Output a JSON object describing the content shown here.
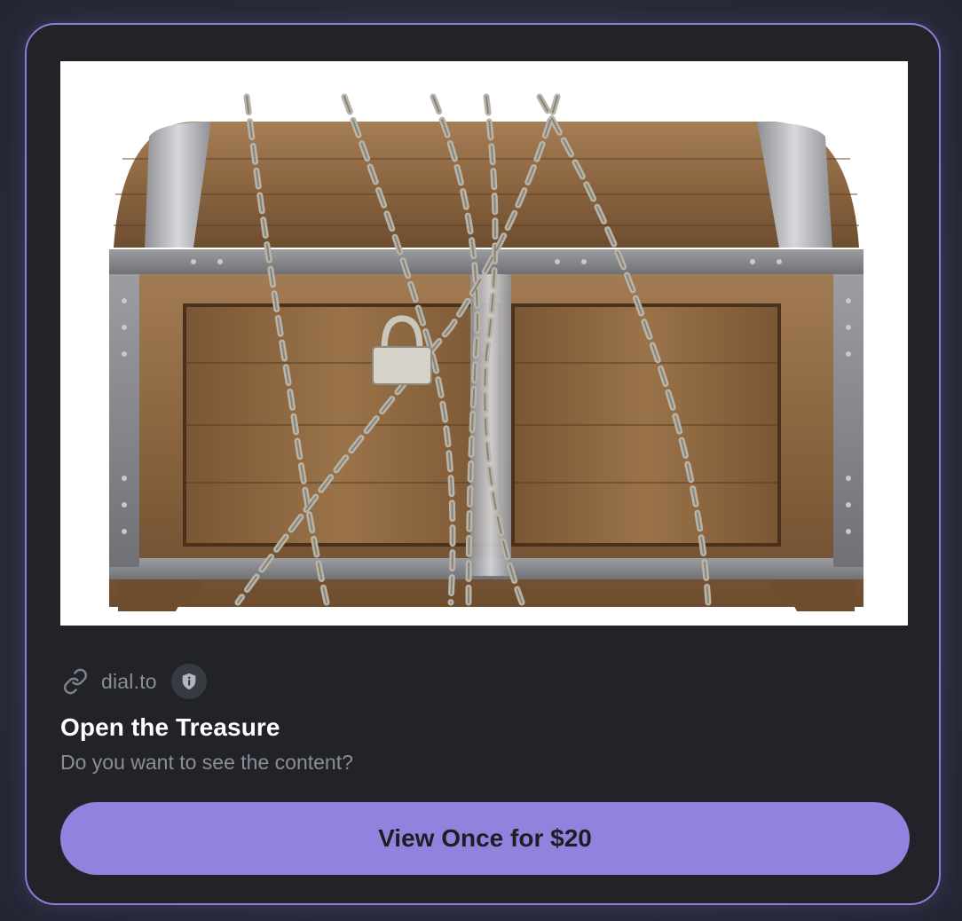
{
  "card": {
    "image_alt": "wooden treasure chest wrapped in chains with a padlock",
    "domain": "dial.to",
    "title": "Open the Treasure",
    "description": "Do you want to see the content?",
    "action_label": "View Once for $20"
  },
  "colors": {
    "accent": "#9282dd",
    "card_border": "#8d7bd6",
    "card_bg": "#222328",
    "muted_text": "#8b8d97"
  },
  "icons": {
    "link": "link-icon",
    "badge": "shield-info-icon"
  }
}
